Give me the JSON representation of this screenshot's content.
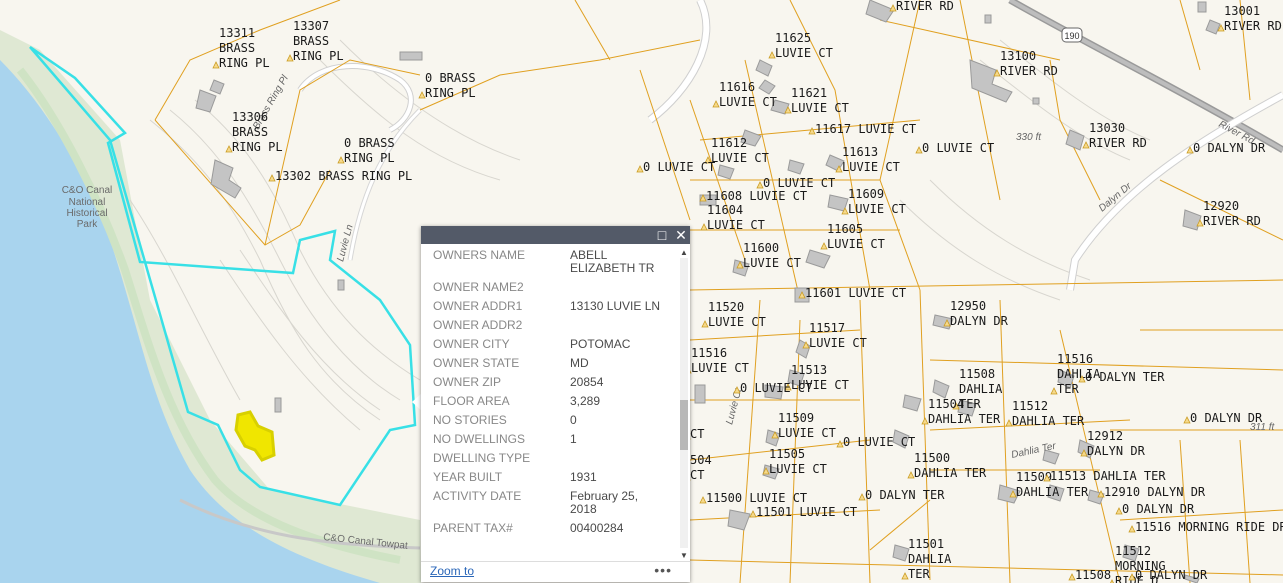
{
  "map": {
    "park_label": [
      "C&O Canal",
      "National",
      "Historical",
      "Park"
    ],
    "towpath_label": "C&O Canal Towpat",
    "road_labels": {
      "brass_ring": "Brass Ring Pl",
      "luvie_ln": "Luvie Ln",
      "dalyn_dr": "Dalyn Dr",
      "river_rd": "River Rd",
      "luvie_ct": "Luvie Ct",
      "dahlia_ter": "Dahlia Ter",
      "route": "190"
    },
    "elevations": [
      "330 ft",
      "311 ft"
    ],
    "parcels": [
      [
        "13311",
        "BRASS",
        "RING PL"
      ],
      [
        "13307",
        "BRASS",
        "RING PL"
      ],
      [
        "0 BRASS",
        "RING PL"
      ],
      [
        "13306",
        "BRASS",
        "RING PL"
      ],
      [
        "0 BRASS",
        "RING PL"
      ],
      [
        "13302 BRASS RING PL"
      ],
      [
        "11625",
        "LUVIE CT"
      ],
      [
        "11616",
        "LUVIE CT"
      ],
      [
        "11621",
        "LUVIE CT"
      ],
      [
        "11617 LUVIE CT"
      ],
      [
        "11612",
        "LUVIE CT"
      ],
      [
        "0 LUVIE CT"
      ],
      [
        "11613",
        "LUVIE CT"
      ],
      [
        "0 LUVIE CT"
      ],
      [
        "0 LUVIE CT"
      ],
      [
        "11608 LUVIE CT"
      ],
      [
        "11609",
        "LUVIE CT"
      ],
      [
        "11604",
        "LUVIE CT"
      ],
      [
        "11605",
        "LUVIE CT"
      ],
      [
        "11600",
        "LUVIE CT"
      ],
      [
        "11601 LUVIE CT"
      ],
      [
        "11520",
        "LUVIE CT"
      ],
      [
        "11517",
        "LUVIE CT"
      ],
      [
        "11516",
        "LUVIE CT"
      ],
      [
        "11513",
        "LUVIE CT"
      ],
      [
        "0 LUVIE CT"
      ],
      [
        "11509",
        "LUVIE CT"
      ],
      [
        "0 LUVIE CT"
      ],
      [
        "11505",
        "LUVIE CT"
      ],
      [
        "11500 LUVIE CT"
      ],
      [
        "11501 LUVIE CT"
      ],
      [
        "504",
        "CT"
      ],
      [
        "CT"
      ],
      [
        "RIVER RD"
      ],
      [
        "13001",
        "RIVER RD"
      ],
      [
        "13100",
        "RIVER RD"
      ],
      [
        "13030",
        "RIVER RD"
      ],
      [
        "0 DALYN DR"
      ],
      [
        "12920",
        "RIVER RD"
      ],
      [
        "12950",
        "DALYN DR"
      ],
      [
        "11508",
        "DAHLIA",
        "TER"
      ],
      [
        "11516",
        "DAHLIA",
        "TER"
      ],
      [
        "0 DALYN TER"
      ],
      [
        "11504",
        "DAHLIA TER"
      ],
      [
        "11512",
        "DAHLIA TER"
      ],
      [
        "0 DALYN DR"
      ],
      [
        "12912",
        "DALYN DR"
      ],
      [
        "11500",
        "DAHLIA TER"
      ],
      [
        "11509",
        "DAHLIA TER"
      ],
      [
        "11513 DAHLIA TER"
      ],
      [
        "12910 DALYN DR"
      ],
      [
        "0 DALYN TER"
      ],
      [
        "0 DALYN DR"
      ],
      [
        "11516 MORNING RIDE DR"
      ],
      [
        "11501",
        "DAHLIA",
        "TER"
      ],
      [
        "11512",
        "MORNING",
        "RIDE D"
      ],
      [
        "11508"
      ],
      [
        "0 DALYN DR"
      ]
    ]
  },
  "popup": {
    "maximize_icon": "maximize-icon",
    "close_icon": "close-icon",
    "fields": [
      {
        "key": "OWNERS NAME",
        "value": "ABELL ELIZABETH TR"
      },
      {
        "key": "OWNER NAME2",
        "value": ""
      },
      {
        "key": "OWNER ADDR1",
        "value": "13130 LUVIE LN"
      },
      {
        "key": "OWNER ADDR2",
        "value": ""
      },
      {
        "key": "OWNER CITY",
        "value": "POTOMAC"
      },
      {
        "key": "OWNER STATE",
        "value": "MD"
      },
      {
        "key": "OWNER ZIP",
        "value": "20854"
      },
      {
        "key": "FLOOR AREA",
        "value": "3,289"
      },
      {
        "key": "NO STORIES",
        "value": "0"
      },
      {
        "key": "NO DWELLINGS",
        "value": "1"
      },
      {
        "key": "DWELLING TYPE",
        "value": ""
      },
      {
        "key": "YEAR BUILT",
        "value": "1931"
      },
      {
        "key": "ACTIVITY DATE",
        "value": "February 25, 2018"
      },
      {
        "key": "PARENT TAX#",
        "value": "00400284"
      }
    ],
    "zoom_label": "Zoom to",
    "more_label": "•••"
  },
  "colors": {
    "water": "#a9d4ee",
    "parcel_line": "#e0a020",
    "selection": "#38e0e6",
    "highlight": "#f0e600",
    "popup_header": "#535a68"
  }
}
